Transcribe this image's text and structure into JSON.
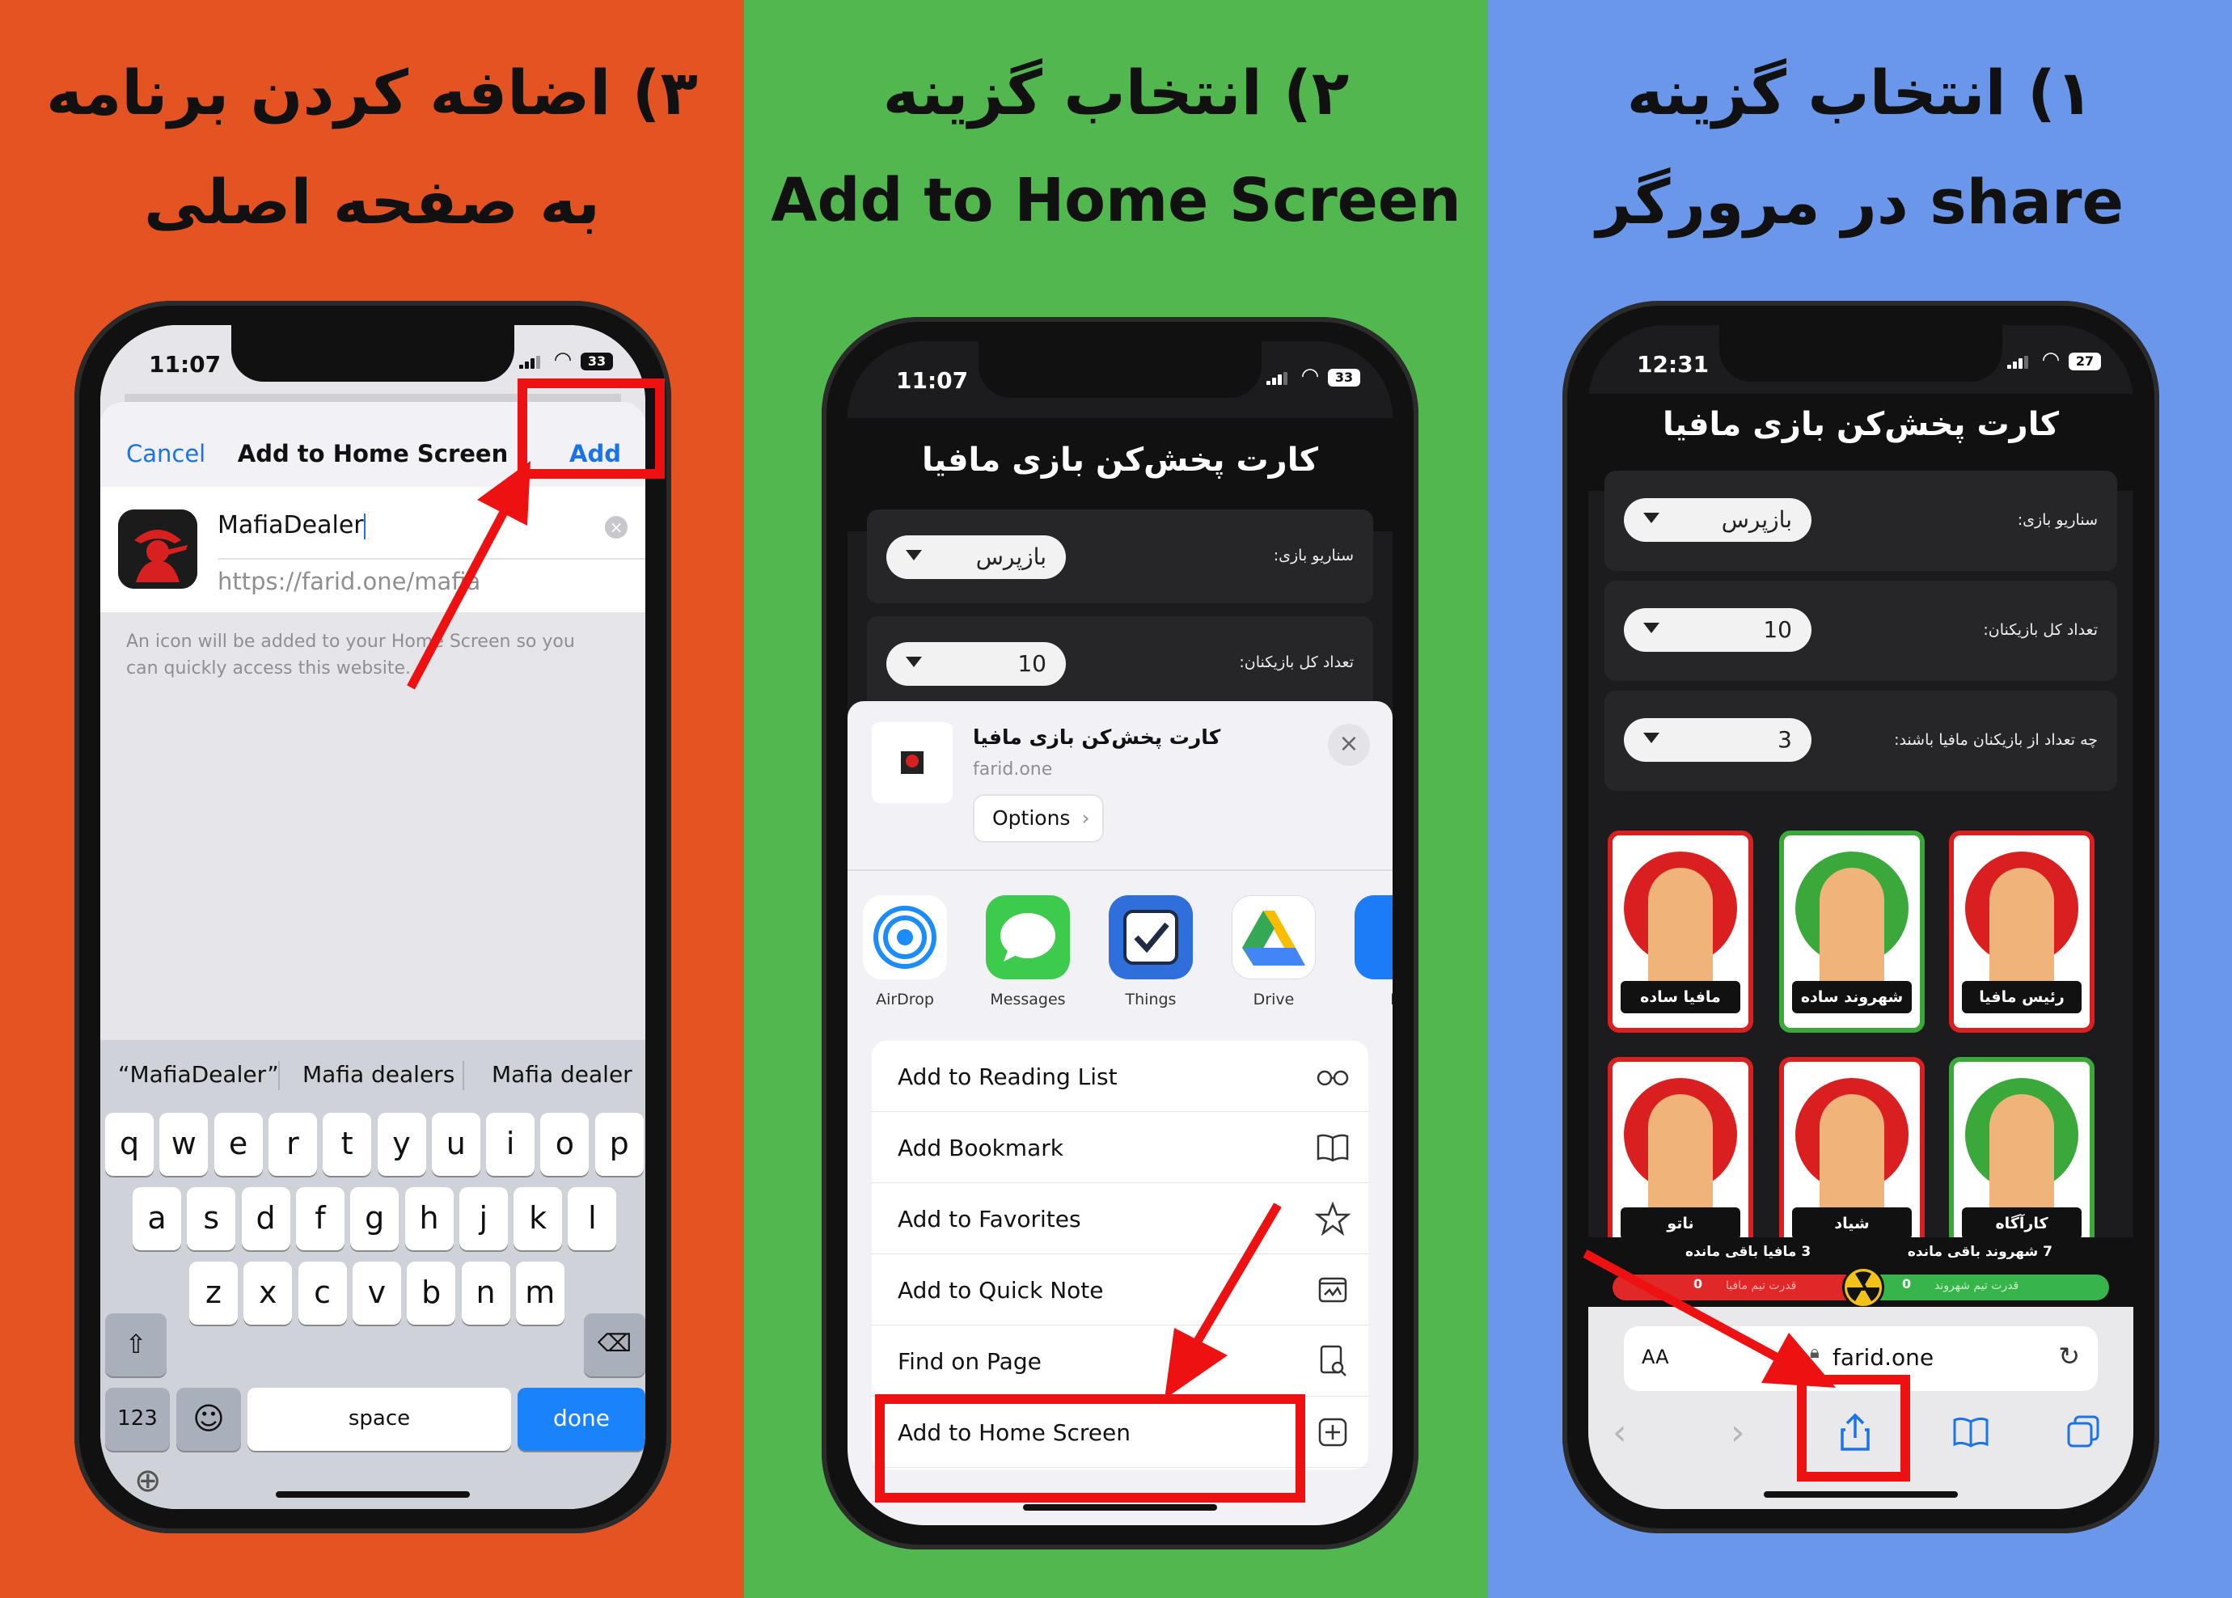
{
  "panels": [
    {
      "title_line1": "۳) اضافه کردن برنامه",
      "title_line2": "به صفحه اصلی"
    },
    {
      "title_line1": "۲) انتخاب گزینه",
      "title_line2": "Add to Home Screen"
    },
    {
      "title_line1": "۱) انتخاب گزینه",
      "title_line2": "share در مرورگر"
    }
  ],
  "phone1": {
    "time": "11:07",
    "battery": "33",
    "nav": {
      "cancel": "Cancel",
      "title": "Add to Home Screen",
      "add": "Add"
    },
    "app_name": "MafiaDealer",
    "url": "https://farid.one/mafia",
    "hint": "An icon will be added to your Home Screen so you can quickly access this website.",
    "suggestions": [
      "“MafiaDealer”",
      "Mafia dealers",
      "Mafia dealer"
    ],
    "row1": [
      "q",
      "w",
      "e",
      "r",
      "t",
      "y",
      "u",
      "i",
      "o",
      "p"
    ],
    "row2": [
      "a",
      "s",
      "d",
      "f",
      "g",
      "h",
      "j",
      "k",
      "l"
    ],
    "row3": [
      "z",
      "x",
      "c",
      "v",
      "b",
      "n",
      "m"
    ],
    "key_123": "123",
    "key_space": "space",
    "key_done": "done"
  },
  "phone2": {
    "time": "11:07",
    "battery": "33",
    "page_title": "کارت پخش‌کن بازی مافیا",
    "scenario_label": "سناریو بازی:",
    "scenario_value": "بازپرس",
    "players_label": "تعداد کل بازیکنان:",
    "players_value": "10",
    "share_title": "کارت پخش‌کن بازی مافیا",
    "share_domain": "farid.one",
    "options": "Options",
    "apps": [
      {
        "name": "AirDrop",
        "color": "#1c8cf8"
      },
      {
        "name": "Messages",
        "color": "#3ccb4c"
      },
      {
        "name": "Things",
        "color": "#2f6fdc"
      },
      {
        "name": "Drive",
        "color": "#ffffff"
      },
      {
        "name": "Li",
        "color": "#1c7cf8"
      }
    ],
    "menu": [
      "Add to Reading List",
      "Add Bookmark",
      "Add to Favorites",
      "Add to Quick Note",
      "Find on Page",
      "Add to Home Screen"
    ]
  },
  "phone3": {
    "time": "12:31",
    "battery": "27",
    "page_title": "کارت پخش‌کن بازی مافیا",
    "scenario_label": "سناریو بازی:",
    "scenario_value": "بازپرس",
    "players_label": "تعداد کل بازیکنان:",
    "players_value": "10",
    "mafia_label": "چه تعداد از بازیکنان مافیا باشند:",
    "mafia_value": "3",
    "cards": [
      {
        "name": "رئیس مافیا",
        "team": "mafia"
      },
      {
        "name": "شهروند ساده",
        "team": "citizen"
      },
      {
        "name": "مافیا ساده",
        "team": "mafia"
      },
      {
        "name": "کارآگاه",
        "team": "citizen"
      },
      {
        "name": "شیاد",
        "team": "mafia"
      },
      {
        "name": "ناتو",
        "team": "mafia"
      }
    ],
    "citizens_left": "7 شهروند باقی مانده",
    "mafia_left": "3 مافیا باقی مانده",
    "citizen_power_label": "قدرت تیم شهروند",
    "citizen_power_value": "0",
    "mafia_power_label": "قدرت تیم مافیا",
    "mafia_power_value": "0",
    "address": "farid.one",
    "aa": "AA"
  },
  "colors": {
    "orange": "#e45422",
    "green": "#52b74f",
    "blue": "#6b97ea",
    "highlight": "#ee1111",
    "ios_blue": "#1a73e8"
  }
}
